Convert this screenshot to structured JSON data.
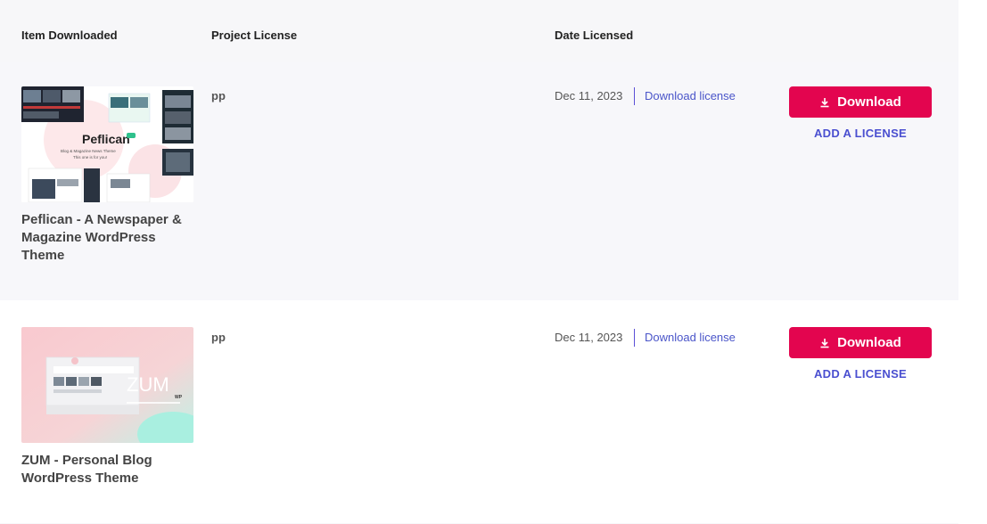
{
  "columns": {
    "item": "Item Downloaded",
    "license": "Project License",
    "date": "Date Licensed"
  },
  "rows": [
    {
      "thumbnail": {
        "brand": "Peflican",
        "badge": "WP",
        "tagline": "Blog & Magazine News Theme",
        "subtagline": "This one is for you!"
      },
      "name": "Peflican - A Newspaper & Magazine WordPress Theme",
      "license": "pp",
      "date": "Dec 11, 2023",
      "download_license": "Download license",
      "download_button": "Download",
      "add_license": "ADD A LICENSE"
    },
    {
      "thumbnail": {
        "brand": "ZUM",
        "badge": "WP"
      },
      "name": "ZUM - Personal Blog WordPress Theme",
      "license": "pp",
      "date": "Dec 11, 2023",
      "download_license": "Download license",
      "download_button": "Download",
      "add_license": "ADD A LICENSE"
    }
  ],
  "colors": {
    "download_button": "#e3054f",
    "link": "#4a55c9",
    "row_alt_bg": "#f7f7fa"
  }
}
